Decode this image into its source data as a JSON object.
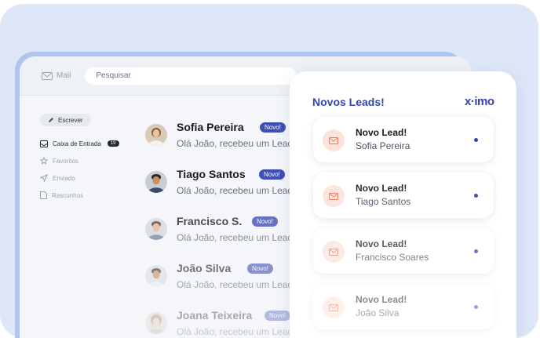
{
  "mail": {
    "app_label": "Mail",
    "search_placeholder": "Pesquisar",
    "compose_label": "Escrever",
    "sidebar": [
      {
        "label": "Caixa de Entrada",
        "count": "19",
        "icon": "inbox-icon",
        "active": true
      },
      {
        "label": "Favoritos",
        "icon": "star-icon"
      },
      {
        "label": "Enviado",
        "icon": "send-icon"
      },
      {
        "label": "Rascunhos",
        "icon": "draft-icon"
      }
    ],
    "messages": [
      {
        "name": "Sofia Pereira",
        "badge": "Novo!",
        "preview": "Olá João, recebeu um Lead"
      },
      {
        "name": "Tiago Santos",
        "badge": "Novo!",
        "preview": "Olá João, recebeu um Lead"
      },
      {
        "name": "Francisco S.",
        "badge": "Novo!",
        "preview": "Olá João, recebeu um Lead"
      },
      {
        "name": "João Silva",
        "badge": "Novo!",
        "preview": "Olá João, recebeu um Lead"
      },
      {
        "name": "Joana Teixeira",
        "badge": "Novo!",
        "preview": "Olá João, recebeu um Lead"
      }
    ]
  },
  "panel": {
    "title": "Novos Leads!",
    "logo": "x·imo",
    "leads": [
      {
        "title": "Novo Lead!",
        "name": "Sofia Pereira"
      },
      {
        "title": "Novo Lead!",
        "name": "Tiago Santos"
      },
      {
        "title": "Novo Lead!",
        "name": "Francisco Soares"
      },
      {
        "title": "Novo Lead!",
        "name": "João Silva"
      }
    ]
  },
  "colors": {
    "accent": "#3346a8",
    "badge": "#3f4fb5",
    "lead_icon_bg": "#fde2da",
    "background": "#dde7f8"
  }
}
